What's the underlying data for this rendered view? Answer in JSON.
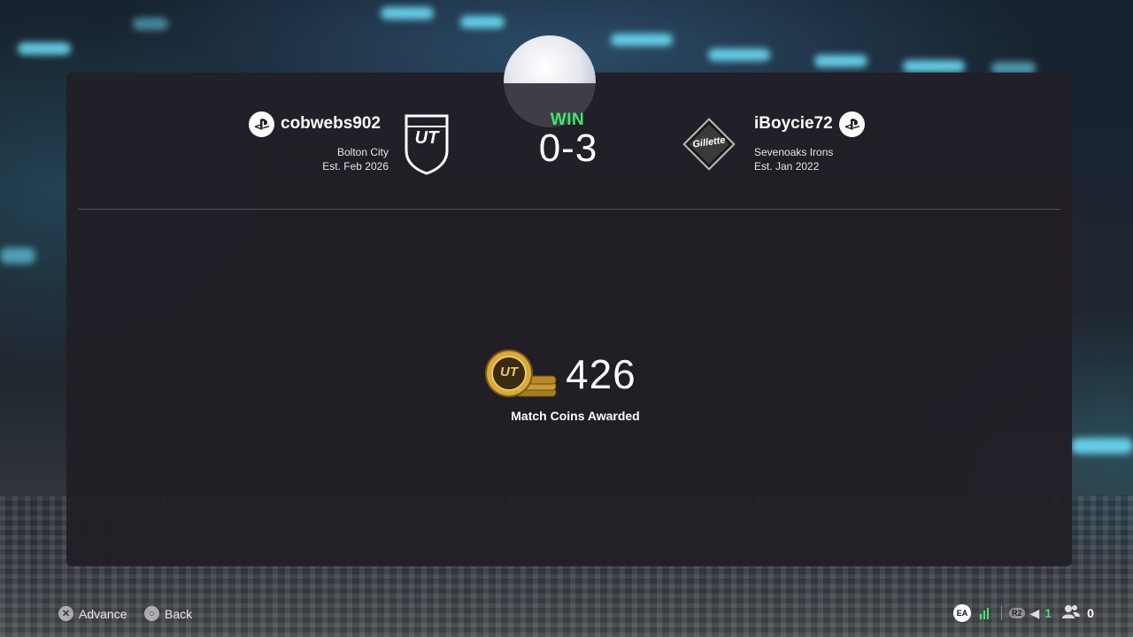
{
  "home": {
    "username": "cobwebs902",
    "club": "Bolton City",
    "established": "Est. Feb 2026",
    "crest_text": "UT"
  },
  "away": {
    "username": "iBoycie72",
    "club": "Sevenoaks Irons",
    "established": "Est. Jan 2022",
    "crest_text": "Gillette"
  },
  "result": {
    "label": "WIN",
    "score": "0-3",
    "label_color": "#3dea6a"
  },
  "coins": {
    "amount": "426",
    "label": "Match Coins Awarded",
    "coin_text": "UT"
  },
  "footer": {
    "advance_label": "Advance",
    "back_label": "Back"
  },
  "status_bar": {
    "ea_label": "EA",
    "r2_label": "R2",
    "notification_count": "1",
    "friends_count": "0"
  }
}
